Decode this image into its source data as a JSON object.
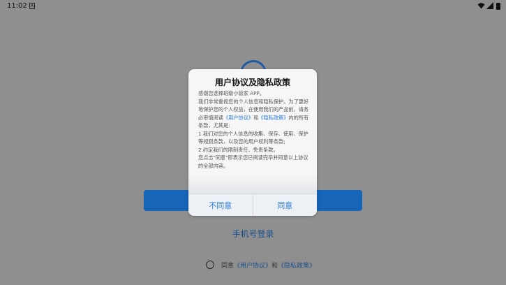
{
  "status_bar": {
    "time": "11:02",
    "notification_glyph": "A"
  },
  "background": {
    "phone_login": "手机号登录",
    "agree_prefix": "同意",
    "agree_user_agreement": "《用户协议》",
    "agree_and": "和",
    "agree_privacy_policy": "《隐私政策》"
  },
  "dialog": {
    "title": "用户协议及隐私政策",
    "lines": {
      "l1": "感谢您选择班级小管家 APP。",
      "l2a": "我们非常重视您的个人信息和隐私保护。为了更好地保护您的个人权益，在使用我们的产品前，请务必审慎阅读",
      "l2_link1": "《用户协议》",
      "l2_and": "和",
      "l2_link2": "《隐私政策》",
      "l2b": "内的所有条款，尤其是:",
      "l3": "1.我们对您的个人信息的收集、保存、使用、保护等规则条款，以及您的用户权利等条款;",
      "l4": "2.约定我们的限制责任、免责条款。",
      "l5": "您点击\"同意\"即表示您已阅读完毕并同意以上协议的全部内容。"
    },
    "disagree_button": "不同意",
    "agree_button": "同意"
  },
  "colors": {
    "accent": "#2a7ad8",
    "primary_button": "#1765b8",
    "scrim": "#8f8f8f"
  }
}
